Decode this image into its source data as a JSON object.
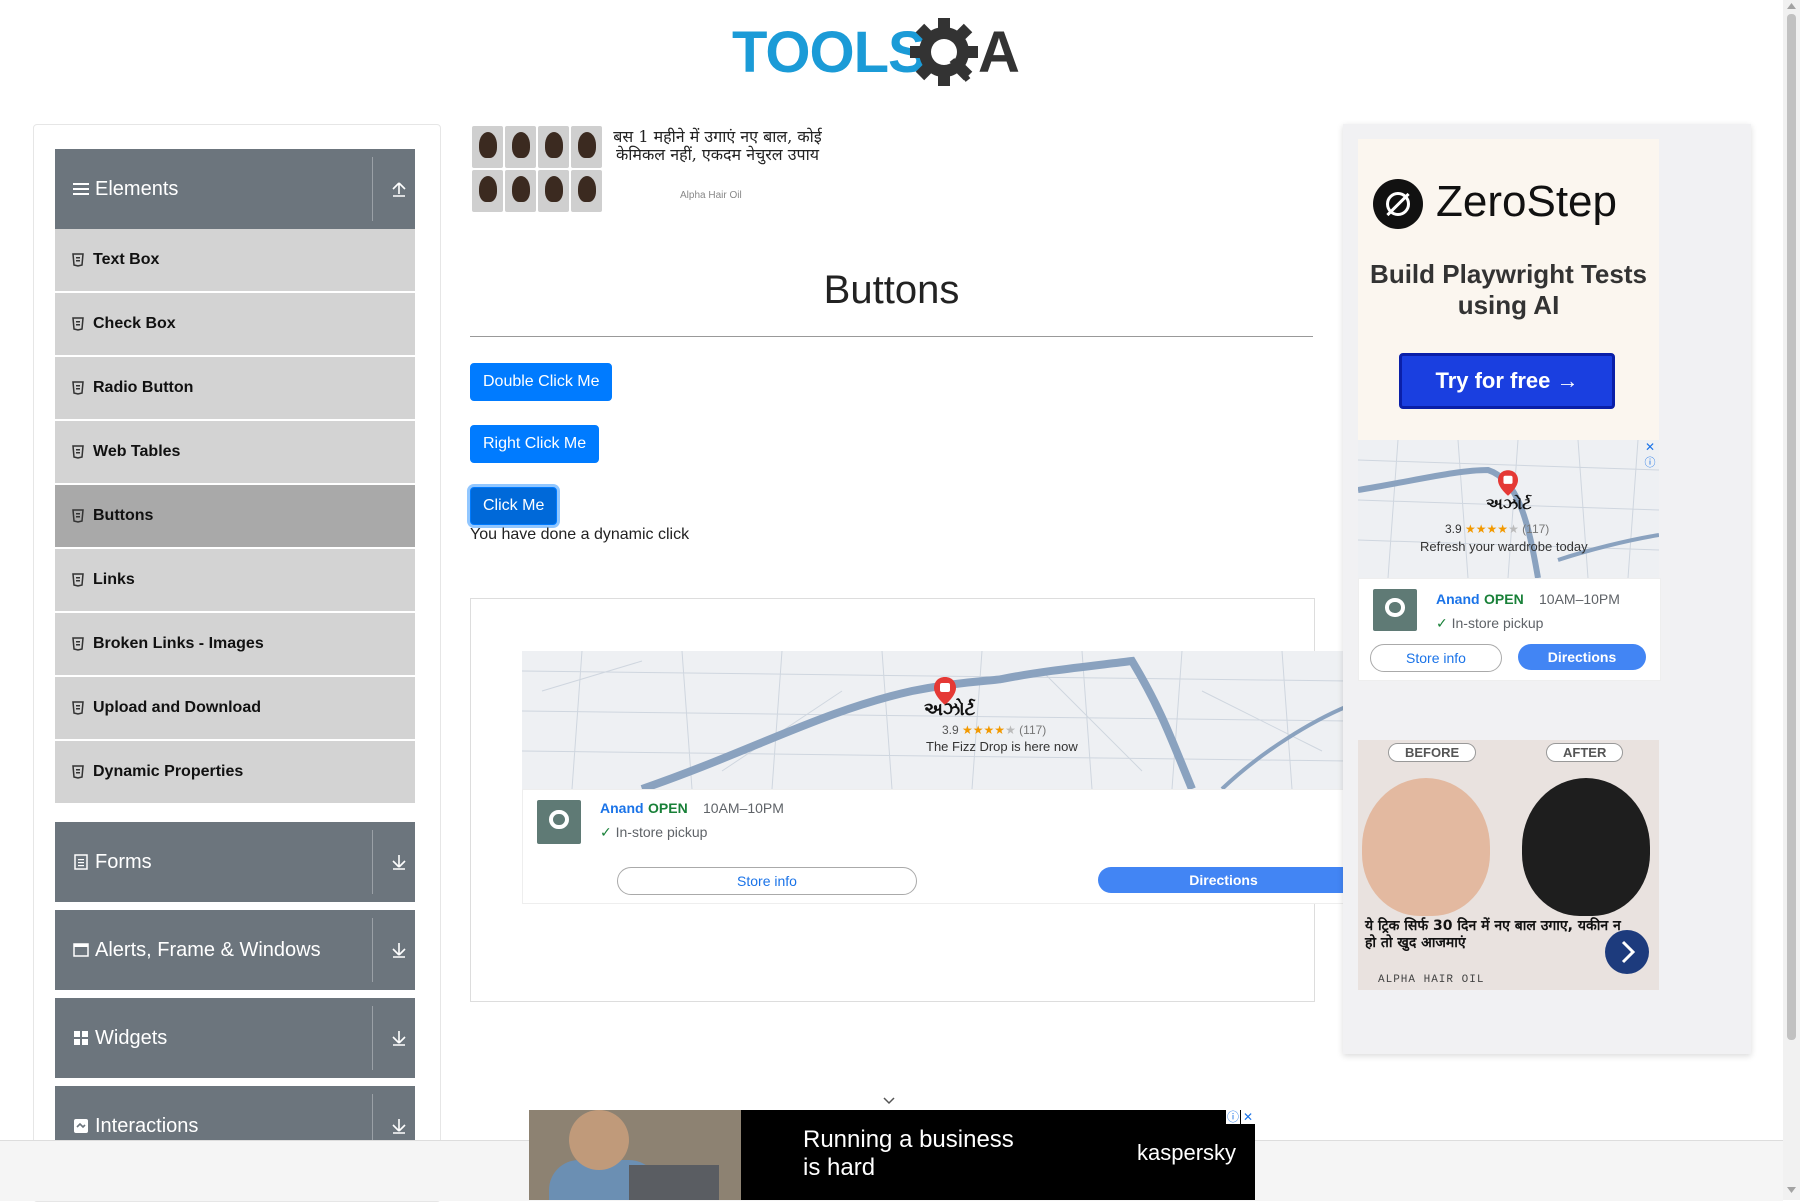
{
  "header": {
    "logo_text_tools": "TOOLS",
    "logo_text_qa": "QA"
  },
  "sidebar": {
    "groups": [
      {
        "title": "Elements",
        "icon": "menu-icon",
        "expanded": true
      },
      {
        "title": "Forms",
        "icon": "document-icon",
        "expanded": false
      },
      {
        "title": "Alerts, Frame & Windows",
        "icon": "window-icon",
        "expanded": false
      },
      {
        "title": "Widgets",
        "icon": "grid-icon",
        "expanded": false
      },
      {
        "title": "Interactions",
        "icon": "interaction-icon",
        "expanded": false
      }
    ],
    "elements_items": [
      "Text Box",
      "Check Box",
      "Radio Button",
      "Web Tables",
      "Buttons",
      "Links",
      "Broken Links - Images",
      "Upload and Download",
      "Dynamic Properties"
    ],
    "active_item": "Buttons"
  },
  "top_ad": {
    "text": "बस 1 महीने में उगाएं नए बाल, कोई केमिकल नहीं, एकदम नेचुरल उपाय",
    "brand": "Alpha Hair Oil"
  },
  "main": {
    "title": "Buttons",
    "double_click_label": "Double Click Me",
    "right_click_label": "Right Click Me",
    "click_label": "Click Me",
    "dynamic_message": "You have done a dynamic click"
  },
  "map_ad": {
    "place": "અઝોર્ટ",
    "rating": "3.9",
    "review_count": "(117)",
    "caption": "The Fizz Drop is here now",
    "store_name": "Anand",
    "status": "OPEN",
    "hours": "10AM–10PM",
    "pickup": "In-store pickup",
    "store_info_label": "Store info",
    "directions_label": "Directions"
  },
  "right_ad": {
    "brand": "ZeroStep",
    "tagline": "Build Playwright Tests using AI",
    "cta": "Try for free →",
    "map": {
      "place": "અઝોર્ટ",
      "rating": "3.9",
      "review_count": "(117)",
      "caption": "Refresh your wardrobe today",
      "store_name": "Anand",
      "status": "OPEN",
      "hours": "10AM–10PM",
      "pickup": "In-store pickup",
      "store_info_label": "Store info",
      "directions_label": "Directions"
    },
    "before_label": "BEFORE",
    "after_label": "AFTER",
    "hair_text": "ये ट्रिक सिर्फ 30 दिन में नए बाल उगाए, यकीन न हो तो खुद आजमाएं",
    "hair_brand": "ALPHA HAIR OIL"
  },
  "bottom_ad": {
    "headline_line1": "Running a business",
    "headline_line2": "is hard",
    "brand": "kaspersky"
  },
  "colors": {
    "primary": "#007bff",
    "sidebar_header": "#6c757d",
    "sidebar_item": "#d3d3d3",
    "sidebar_item_active": "#a9a9a9",
    "logo_blue": "#1b9bd7",
    "logo_dark": "#333333"
  }
}
